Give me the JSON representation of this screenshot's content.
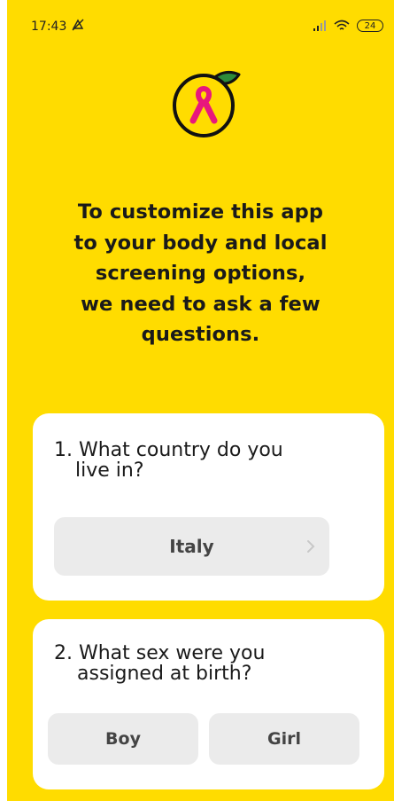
{
  "status_bar": {
    "time": "17:43",
    "battery": "24",
    "icons": [
      "dnd-off-icon",
      "signal-icon",
      "wifi-icon",
      "battery-icon"
    ]
  },
  "logo": {
    "icon": "lemon-pink-ribbon-logo"
  },
  "intro": {
    "lines": [
      "To customize this app",
      "to your body and local",
      "screening options,",
      "we need to ask a few",
      "questions."
    ]
  },
  "questions": [
    {
      "number_label": "1.",
      "lines": [
        "1. What country do you",
        "live in?"
      ],
      "selected_value": "Italy"
    },
    {
      "number_label": "2.",
      "lines": [
        "2. What sex were you",
        "assigned at birth?"
      ],
      "options": [
        "Boy",
        "Girl"
      ]
    }
  ],
  "colors": {
    "background": "#FFDC00",
    "card": "#FFFFFF",
    "button": "#EBEBEB",
    "ribbon": "#E8177D",
    "leaf": "#2E8B3A"
  }
}
